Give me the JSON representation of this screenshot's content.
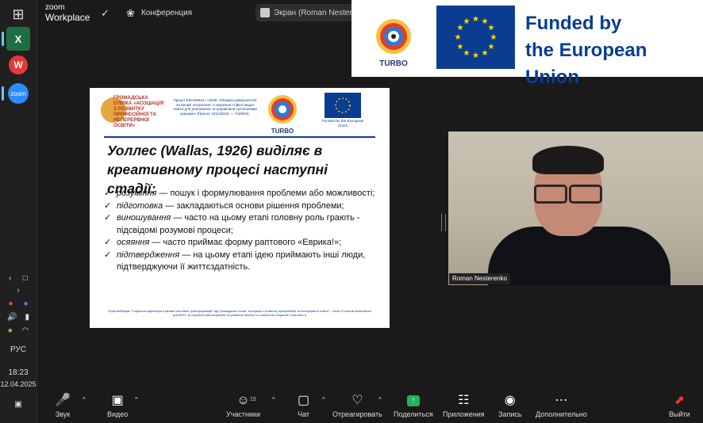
{
  "taskbar": {
    "tray": {
      "language": "РУС",
      "time": "18:23",
      "date": "12.04.2025"
    }
  },
  "zoom_header": {
    "logo_line1": "zoom",
    "logo_line2": "Workplace",
    "meeting_label": "Конференция",
    "share_pill": "Экран (Roman Nesterenko)"
  },
  "eu_banner": {
    "logo_label": "TURBO",
    "line1": "Funded by",
    "line2": "the European Union"
  },
  "slide": {
    "assoc_title": "Громадська спілка «Асоціація з розвитку професійної та неперервної освіти»",
    "project_text": "Проєкт ERASMUS+ CBHE «Реакція університетів на великі потрясіння: Створення стійкої вищої освіти для реагування та управління суспільними кризами» (Проєкт 101129315 — TURBO).",
    "turbo_label": "TURBO",
    "eu_label": "Funded by the European Union",
    "title": "Уоллес (Wallas, 1926) виділяє в креативному процесі наступні стадії:",
    "items": [
      {
        "term": "розуміння",
        "text": " — пошук і формулювання проблеми або можливості;"
      },
      {
        "term": "підготовка",
        "text": " — закладаються основи рішення проблеми;"
      },
      {
        "term": "виношування",
        "text": " — часто на цьому етапі головну роль грають - підсвідомі розумові процеси;"
      },
      {
        "term": "осяяння",
        "text": " — часто приймає форму раптового «Еврика!»;"
      },
      {
        "term": "підтвердження",
        "text": " — на цьому етапі ідею приймають інші люди, підтверджуючи її життєздатність."
      }
    ],
    "footer": "Серія вебінарів \"Соціальна адаптація в умовах життєвих трансформацій\" від Громадської спілки \"Асоціація з розвитку професійної та неперервної освіти\" – Блок «Грантові можливості для ВПО: як отримати фінансування на розвиток бізнесу та соціальних ініціатив» (Частина I)"
  },
  "video": {
    "participant_name": "Roman Nesterenko"
  },
  "toolbar": {
    "audio": "Звук",
    "video": "Видео",
    "participants": "Участники",
    "participants_count": "15",
    "chat": "Чат",
    "react": "Отреагировать",
    "share": "Поделиться",
    "apps": "Приложения",
    "record": "Запись",
    "more": "Дополнительно",
    "leave": "Выйти"
  }
}
